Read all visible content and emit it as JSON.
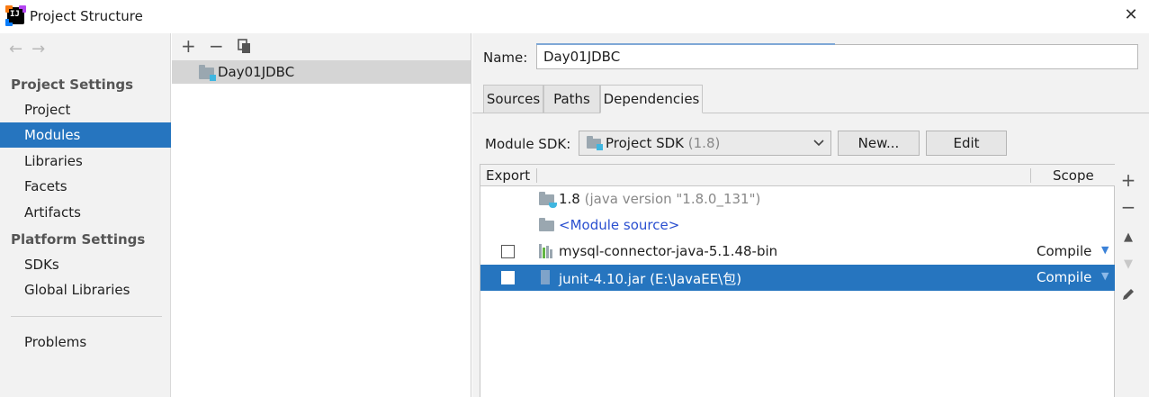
{
  "window": {
    "title": "Project Structure",
    "close_icon": "close-icon"
  },
  "sidebar": {
    "back_icon": "arrow-left-icon",
    "forward_icon": "arrow-right-icon",
    "nav_arrows": "← →",
    "project_settings_header": "Project Settings",
    "project_settings_items": [
      "Project",
      "Modules",
      "Libraries",
      "Facets",
      "Artifacts"
    ],
    "platform_settings_header": "Platform Settings",
    "platform_settings_items": [
      "SDKs",
      "Global Libraries"
    ],
    "problems": "Problems",
    "selected": "Modules",
    "accent_color": "#2675bf"
  },
  "modules_panel": {
    "toolbar": {
      "add": "+",
      "remove": "−",
      "copy_icon": "copy-icon"
    },
    "items": [
      "Day01JDBC"
    ]
  },
  "module_editor": {
    "name_label": "Name:",
    "name_value": "Day01JDBC",
    "tabs": [
      "Sources",
      "Paths",
      "Dependencies"
    ],
    "active_tab": "Dependencies",
    "module_sdk_label": "Module SDK:",
    "module_sdk_value": "Project SDK",
    "module_sdk_version": "(1.8)",
    "new_button": "New...",
    "edit_button": "Edit",
    "table": {
      "columns": [
        "Export",
        "Scope"
      ],
      "rows": [
        {
          "name": "1.8",
          "detail": "(java version \"1.8.0_131\")",
          "checkbox": false,
          "scope": ""
        },
        {
          "name": "<Module source>",
          "detail": "",
          "checkbox": false,
          "scope": ""
        },
        {
          "name": "mysql-connector-java-5.1.48-bin",
          "detail": "",
          "checkbox": true,
          "scope": "Compile"
        },
        {
          "name": "junit-4.10.jar (E:\\JavaEE\\包)",
          "detail": "",
          "checkbox": true,
          "scope": "Compile",
          "selected": true
        }
      ]
    },
    "side_tools": {
      "add": "+",
      "remove": "−",
      "up": "▲",
      "down": "▼",
      "edit_icon": "pencil-icon"
    }
  }
}
